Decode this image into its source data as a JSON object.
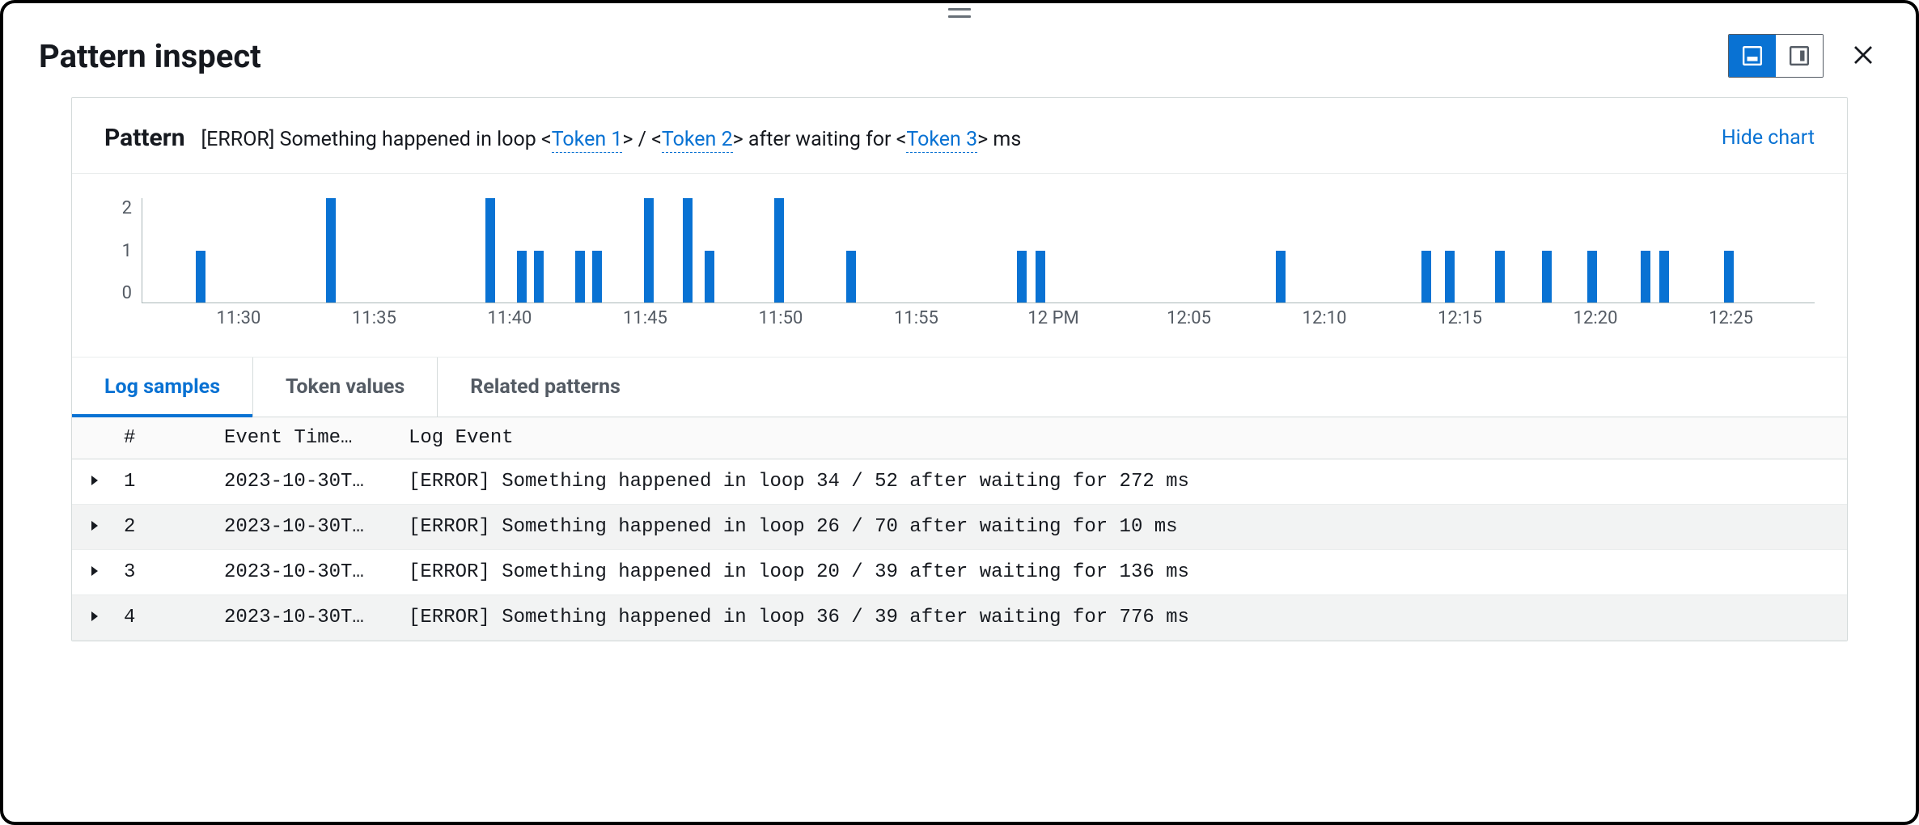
{
  "header": {
    "title": "Pattern inspect"
  },
  "pattern": {
    "label": "Pattern",
    "prefix": "[ERROR] Something happened in loop <",
    "token1": "Token 1",
    "mid1": "> / <",
    "token2": "Token 2",
    "mid2": "> after waiting for <",
    "token3": "Token 3",
    "suffix": "> ms",
    "hide_chart_label": "Hide chart"
  },
  "chart_data": {
    "type": "bar",
    "ylim": [
      0,
      2
    ],
    "yticks": [
      0,
      1,
      2
    ],
    "xticks": [
      "11:30",
      "11:35",
      "11:40",
      "11:45",
      "11:50",
      "11:55",
      "12 PM",
      "12:05",
      "12:10",
      "12:15",
      "12:20",
      "12:25"
    ],
    "xtick_pos": [
      5.8,
      13.9,
      22.0,
      30.1,
      38.2,
      46.3,
      54.5,
      62.6,
      70.7,
      78.8,
      86.9,
      95.0
    ],
    "bars": [
      {
        "x": 3.2,
        "value": 1
      },
      {
        "x": 11.0,
        "value": 2
      },
      {
        "x": 20.5,
        "value": 2
      },
      {
        "x": 22.4,
        "value": 1
      },
      {
        "x": 23.4,
        "value": 1
      },
      {
        "x": 25.9,
        "value": 1
      },
      {
        "x": 26.9,
        "value": 1
      },
      {
        "x": 30.0,
        "value": 2
      },
      {
        "x": 32.3,
        "value": 2
      },
      {
        "x": 33.6,
        "value": 1
      },
      {
        "x": 37.8,
        "value": 2
      },
      {
        "x": 42.1,
        "value": 1
      },
      {
        "x": 52.3,
        "value": 1
      },
      {
        "x": 53.4,
        "value": 1
      },
      {
        "x": 67.8,
        "value": 1
      },
      {
        "x": 76.5,
        "value": 1
      },
      {
        "x": 77.9,
        "value": 1
      },
      {
        "x": 80.9,
        "value": 1
      },
      {
        "x": 83.7,
        "value": 1
      },
      {
        "x": 86.4,
        "value": 1
      },
      {
        "x": 89.6,
        "value": 1
      },
      {
        "x": 90.7,
        "value": 1
      },
      {
        "x": 94.6,
        "value": 1
      }
    ]
  },
  "tabs": [
    {
      "label": "Log samples",
      "active": true
    },
    {
      "label": "Token values",
      "active": false
    },
    {
      "label": "Related patterns",
      "active": false
    }
  ],
  "table": {
    "headers": {
      "num": "#",
      "time": "Event Time…",
      "event": "Log Event"
    },
    "rows": [
      {
        "num": "1",
        "time": "2023-10-30T…",
        "event": "[ERROR] Something happened in loop 34 / 52 after waiting for 272 ms"
      },
      {
        "num": "2",
        "time": "2023-10-30T…",
        "event": "[ERROR] Something happened in loop 26 / 70 after waiting for 10 ms"
      },
      {
        "num": "3",
        "time": "2023-10-30T…",
        "event": "[ERROR] Something happened in loop 20 / 39 after waiting for 136 ms"
      },
      {
        "num": "4",
        "time": "2023-10-30T…",
        "event": "[ERROR] Something happened in loop 36 / 39 after waiting for 776 ms"
      }
    ]
  }
}
